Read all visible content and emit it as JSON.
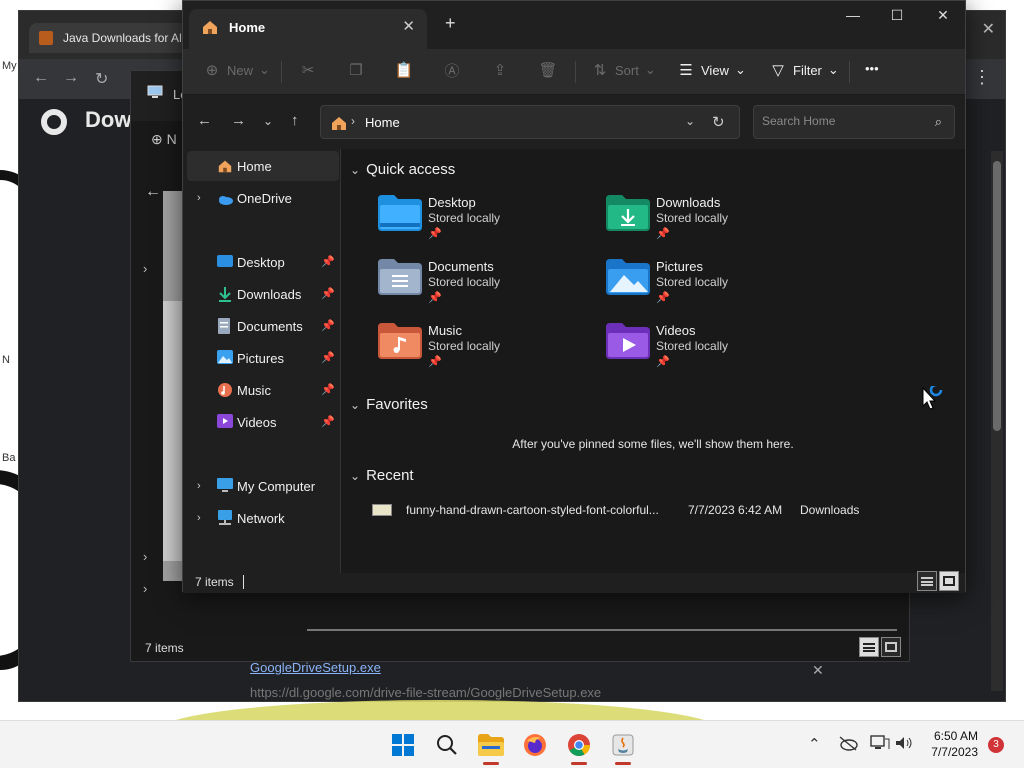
{
  "desktop": {
    "labels": [
      "My",
      "N",
      "Ba"
    ],
    "chrome": {
      "tab_title": "Java Downloads for All",
      "page_heading": "Dow",
      "download": {
        "name": "GoogleDriveSetup.exe",
        "url": "https://dl.google.com/drive-file-stream/GoogleDriveSetup.exe"
      }
    },
    "bg_explorer": {
      "tab_title": "Lo",
      "new_label": "N",
      "status": "7 items"
    }
  },
  "explorer": {
    "tab": {
      "title": "Home"
    },
    "toolbar": {
      "new": "New",
      "sort": "Sort",
      "view": "View",
      "filter": "Filter",
      "more": "•••"
    },
    "address": {
      "crumb": "Home"
    },
    "search": {
      "placeholder": "Search Home"
    },
    "sidebar": {
      "home": "Home",
      "onedrive": "OneDrive",
      "pinned": [
        {
          "label": "Desktop",
          "icon": "desktop-icon"
        },
        {
          "label": "Downloads",
          "icon": "download-icon"
        },
        {
          "label": "Documents",
          "icon": "documents-icon"
        },
        {
          "label": "Pictures",
          "icon": "pictures-icon"
        },
        {
          "label": "Music",
          "icon": "music-icon"
        },
        {
          "label": "Videos",
          "icon": "videos-icon"
        }
      ],
      "my_computer": "My Computer",
      "network": "Network"
    },
    "quick_access": {
      "title": "Quick access",
      "items": [
        {
          "name": "Desktop",
          "sub": "Stored locally",
          "icon": "desktop-folder-icon",
          "color": "#1e90e0"
        },
        {
          "name": "Downloads",
          "sub": "Stored locally",
          "icon": "downloads-folder-icon",
          "color": "#1fa67a"
        },
        {
          "name": "Documents",
          "sub": "Stored locally",
          "icon": "documents-folder-icon",
          "color": "#8aa0bd"
        },
        {
          "name": "Pictures",
          "sub": "Stored locally",
          "icon": "pictures-folder-icon",
          "color": "#2e8fe6"
        },
        {
          "name": "Music",
          "sub": "Stored locally",
          "icon": "music-folder-icon",
          "color": "#e0704a"
        },
        {
          "name": "Videos",
          "sub": "Stored locally",
          "icon": "videos-folder-icon",
          "color": "#8a45d6"
        }
      ]
    },
    "favorites": {
      "title": "Favorites",
      "empty_message": "After you've pinned some files, we'll show them here."
    },
    "recent": {
      "title": "Recent",
      "items": [
        {
          "name": "funny-hand-drawn-cartoon-styled-font-colorful...",
          "date": "7/7/2023 6:42 AM",
          "location": "Downloads"
        }
      ]
    },
    "status": {
      "count": "7 items"
    }
  },
  "taskbar": {
    "time": "6:50 AM",
    "date": "7/7/2023",
    "notifications": "3"
  }
}
